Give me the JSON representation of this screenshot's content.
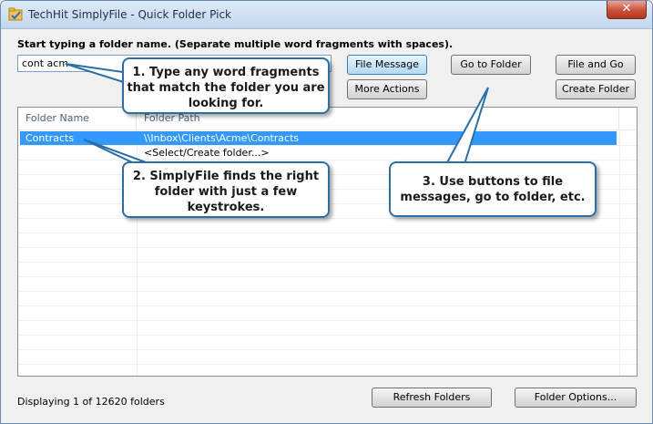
{
  "window": {
    "title": "TechHit SimplyFile - Quick Folder Pick",
    "close_label": "✕"
  },
  "instruction": "Start typing a folder name. (Separate multiple word fragments with spaces).",
  "search": {
    "value": "cont acm"
  },
  "buttons": {
    "file_message": "File Message",
    "go_to_folder": "Go to Folder",
    "file_and_go": "File and Go",
    "more_actions": "More Actions",
    "create_folder": "Create Folder",
    "refresh_folders": "Refresh Folders",
    "folder_options": "Folder Options..."
  },
  "list": {
    "columns": [
      "Folder Name",
      "Folder Path"
    ],
    "rows": [
      {
        "name": "Contracts",
        "path": "\\\\Inbox\\Clients\\Acme\\Contracts",
        "selected": true
      },
      {
        "name": "",
        "path": "<Select/Create folder...>",
        "selected": false
      }
    ]
  },
  "callouts": {
    "one": "1. Type any word fragments that match the folder you are looking for.",
    "two": "2. SimplyFile finds the right folder with just a few keystrokes.",
    "three": "3. Use buttons to file messages, go to folder, etc."
  },
  "status": "Displaying 1 of 12620 folders",
  "colors": {
    "selection": "#3399ff",
    "callout_border": "#2b6ea7",
    "close": "#c9503a"
  }
}
